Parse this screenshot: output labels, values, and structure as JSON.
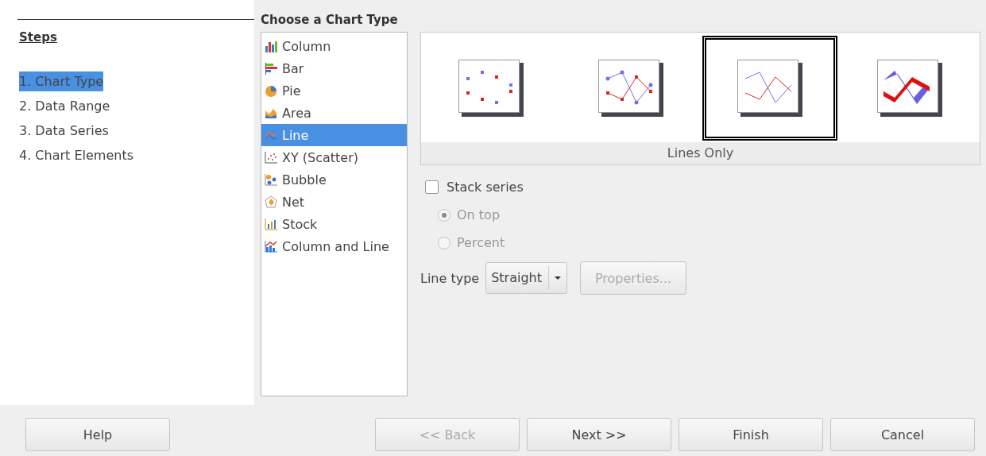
{
  "steps": {
    "title": "Steps",
    "items": [
      {
        "label": "1. Chart Type",
        "selected": true
      },
      {
        "label": "2. Data Range",
        "selected": false
      },
      {
        "label": "3. Data Series",
        "selected": false
      },
      {
        "label": "4. Chart Elements",
        "selected": false
      }
    ]
  },
  "heading": "Choose a Chart Type",
  "chart_types": [
    {
      "label": "Column",
      "kind": "column",
      "selected": false
    },
    {
      "label": "Bar",
      "kind": "bar",
      "selected": false
    },
    {
      "label": "Pie",
      "kind": "pie",
      "selected": false
    },
    {
      "label": "Area",
      "kind": "area",
      "selected": false
    },
    {
      "label": "Line",
      "kind": "line",
      "selected": true
    },
    {
      "label": "XY (Scatter)",
      "kind": "scatter",
      "selected": false
    },
    {
      "label": "Bubble",
      "kind": "bubble",
      "selected": false
    },
    {
      "label": "Net",
      "kind": "net",
      "selected": false
    },
    {
      "label": "Stock",
      "kind": "stock",
      "selected": false
    },
    {
      "label": "Column and Line",
      "kind": "combo",
      "selected": false
    }
  ],
  "variants": [
    {
      "kind": "points",
      "selected": false
    },
    {
      "kind": "points_lines",
      "selected": false
    },
    {
      "kind": "lines",
      "selected": true
    },
    {
      "kind": "lines_3d",
      "selected": false
    }
  ],
  "variant_label": "Lines Only",
  "stack_series": {
    "label": "Stack series",
    "checked": false
  },
  "stack_options": [
    {
      "label": "On top",
      "selected": true,
      "disabled": true
    },
    {
      "label": "Percent",
      "selected": false,
      "disabled": true
    }
  ],
  "line_type": {
    "label": "Line type",
    "value": "Straight"
  },
  "properties_button": {
    "label": "Properties...",
    "disabled": true
  },
  "buttons": [
    {
      "label": "Help",
      "disabled": false,
      "kind": "left"
    },
    {
      "label": "<< Back",
      "disabled": true,
      "kind": "right"
    },
    {
      "label": "Next >>",
      "disabled": false,
      "kind": "right"
    },
    {
      "label": "Finish",
      "disabled": false,
      "kind": "right"
    },
    {
      "label": "Cancel",
      "disabled": false,
      "kind": "right"
    }
  ]
}
